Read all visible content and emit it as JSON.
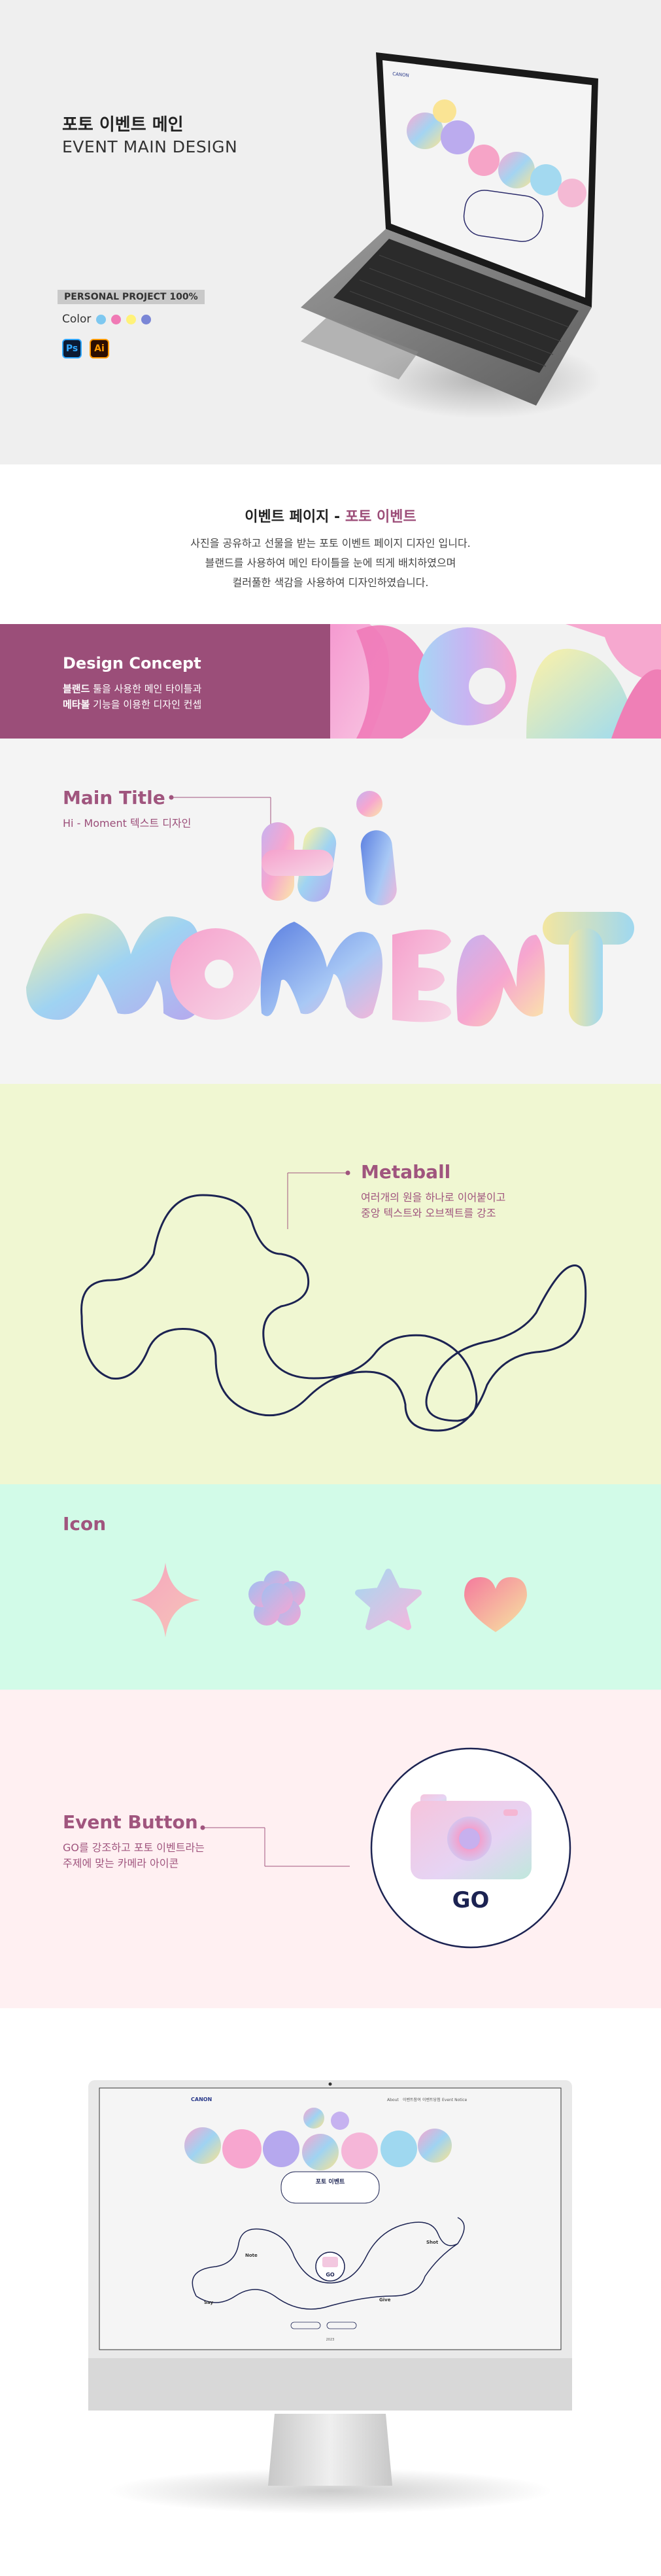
{
  "hero": {
    "title_ko": "포토 이벤트 메인",
    "title_en": "EVENT MAIN DESIGN",
    "badge": "PERSONAL PROJECT 100%",
    "color_label": "Color",
    "colors": [
      "#7ec8f0",
      "#f07ab5",
      "#fff27a",
      "#7a86d6"
    ],
    "tools": [
      "Ps",
      "Ai"
    ],
    "laptop_logo": "CANON"
  },
  "intro": {
    "title_prefix": "이벤트 페이지 - ",
    "title_accent": "포토 이벤트",
    "lines": [
      "사진을 공유하고 선물을 받는 포토 이벤트 페이지 디자인 입니다.",
      "블랜드를 사용하여 메인 타이틀을 눈에 띄게 배치하였으며",
      "컬러풀한 색감을 사용하여 디자인하였습니다."
    ]
  },
  "concept": {
    "heading": "Design Concept",
    "line1_bold": "블랜드",
    "line1_rest": " 툴을 사용한 메인 타이틀과",
    "line2_bold": "메타볼",
    "line2_rest": " 기능을 이용한 디자인 컨셉"
  },
  "main_title": {
    "heading": "Main Title",
    "sub": "Hi - Moment  텍스트 디자인",
    "word1": "HI",
    "word2": "MOMENT"
  },
  "metaball": {
    "heading": "Metaball",
    "line1": "여러개의 원을 하나로 이어붙이고",
    "line2": "중앙 텍스트와 오브젝트를 강조"
  },
  "icons": {
    "heading": "Icon",
    "items": [
      "sparkle-icon",
      "flower-icon",
      "star-icon",
      "heart-icon"
    ]
  },
  "event_button": {
    "heading": "Event Button",
    "line1": "GO를 강조하고 포토 이벤트라는",
    "line2": "주제에 맞는 카메라 아이콘",
    "go_label": "GO"
  },
  "monitor": {
    "logo": "CANON",
    "nav": [
      "About",
      "이벤트참여",
      "이벤트당첨",
      "Event Notice"
    ],
    "event_title": "포토 이벤트",
    "go_label": "GO",
    "nodes": [
      "Note",
      "Shot",
      "Give",
      "Say"
    ],
    "year": "2023"
  }
}
